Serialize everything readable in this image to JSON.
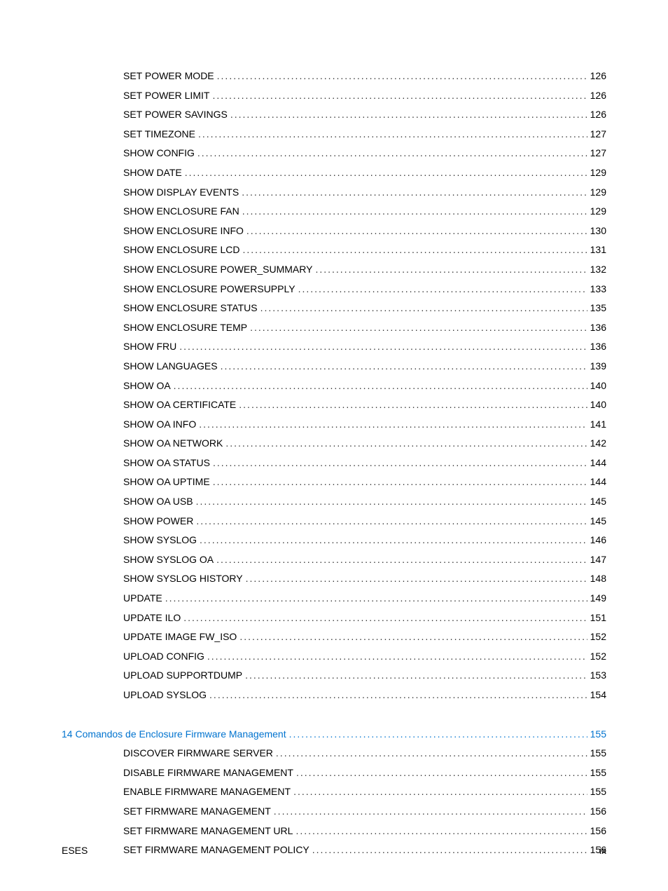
{
  "toc": {
    "items": [
      {
        "label": "SET POWER MODE",
        "page": "126",
        "indent": 1,
        "section": false,
        "link": true
      },
      {
        "label": "SET POWER LIMIT",
        "page": "126",
        "indent": 1,
        "section": false,
        "link": true
      },
      {
        "label": "SET POWER SAVINGS",
        "page": "126",
        "indent": 1,
        "section": false,
        "link": true
      },
      {
        "label": "SET TIMEZONE",
        "page": "127",
        "indent": 1,
        "section": false,
        "link": true
      },
      {
        "label": "SHOW CONFIG",
        "page": "127",
        "indent": 1,
        "section": false,
        "link": true
      },
      {
        "label": "SHOW DATE",
        "page": "129",
        "indent": 1,
        "section": false,
        "link": true
      },
      {
        "label": "SHOW DISPLAY EVENTS",
        "page": "129",
        "indent": 1,
        "section": false,
        "link": true
      },
      {
        "label": "SHOW ENCLOSURE FAN",
        "page": "129",
        "indent": 1,
        "section": false,
        "link": true
      },
      {
        "label": "SHOW ENCLOSURE INFO",
        "page": "130",
        "indent": 1,
        "section": false,
        "link": true
      },
      {
        "label": "SHOW ENCLOSURE LCD",
        "page": "131",
        "indent": 1,
        "section": false,
        "link": true
      },
      {
        "label": "SHOW ENCLOSURE POWER_SUMMARY",
        "page": "132",
        "indent": 1,
        "section": false,
        "link": true
      },
      {
        "label": "SHOW ENCLOSURE POWERSUPPLY",
        "page": "133",
        "indent": 1,
        "section": false,
        "link": true
      },
      {
        "label": "SHOW ENCLOSURE STATUS",
        "page": "135",
        "indent": 1,
        "section": false,
        "link": true
      },
      {
        "label": "SHOW ENCLOSURE TEMP",
        "page": "136",
        "indent": 1,
        "section": false,
        "link": true
      },
      {
        "label": "SHOW FRU",
        "page": "136",
        "indent": 1,
        "section": false,
        "link": true
      },
      {
        "label": "SHOW LANGUAGES",
        "page": "139",
        "indent": 1,
        "section": false,
        "link": true
      },
      {
        "label": "SHOW OA",
        "page": "140",
        "indent": 1,
        "section": false,
        "link": true
      },
      {
        "label": "SHOW OA CERTIFICATE",
        "page": "140",
        "indent": 1,
        "section": false,
        "link": true
      },
      {
        "label": "SHOW OA INFO",
        "page": "141",
        "indent": 1,
        "section": false,
        "link": true
      },
      {
        "label": "SHOW OA NETWORK",
        "page": "142",
        "indent": 1,
        "section": false,
        "link": true
      },
      {
        "label": "SHOW OA STATUS",
        "page": "144",
        "indent": 1,
        "section": false,
        "link": true
      },
      {
        "label": "SHOW OA UPTIME",
        "page": "144",
        "indent": 1,
        "section": false,
        "link": true
      },
      {
        "label": "SHOW OA USB",
        "page": "145",
        "indent": 1,
        "section": false,
        "link": true
      },
      {
        "label": "SHOW POWER",
        "page": "145",
        "indent": 1,
        "section": false,
        "link": true
      },
      {
        "label": "SHOW SYSLOG",
        "page": "146",
        "indent": 1,
        "section": false,
        "link": true
      },
      {
        "label": "SHOW SYSLOG OA",
        "page": "147",
        "indent": 1,
        "section": false,
        "link": true
      },
      {
        "label": "SHOW SYSLOG HISTORY",
        "page": "148",
        "indent": 1,
        "section": false,
        "link": true
      },
      {
        "label": "UPDATE",
        "page": "149",
        "indent": 1,
        "section": false,
        "link": true
      },
      {
        "label": "UPDATE ILO",
        "page": "151",
        "indent": 1,
        "section": false,
        "link": true
      },
      {
        "label": "UPDATE IMAGE FW_ISO",
        "page": "152",
        "indent": 1,
        "section": false,
        "link": true
      },
      {
        "label": "UPLOAD CONFIG",
        "page": "152",
        "indent": 1,
        "section": false,
        "link": true
      },
      {
        "label": "UPLOAD SUPPORTDUMP",
        "page": "153",
        "indent": 1,
        "section": false,
        "link": true
      },
      {
        "label": "UPLOAD SYSLOG",
        "page": "154",
        "indent": 1,
        "section": false,
        "link": true
      },
      {
        "gap": true
      },
      {
        "label": "14  Comandos de Enclosure Firmware Management",
        "page": "155",
        "indent": 0,
        "section": true,
        "link": true
      },
      {
        "label": "DISCOVER FIRMWARE SERVER",
        "page": "155",
        "indent": 1,
        "section": false,
        "link": true
      },
      {
        "label": "DISABLE FIRMWARE MANAGEMENT",
        "page": "155",
        "indent": 1,
        "section": false,
        "link": true
      },
      {
        "label": "ENABLE FIRMWARE MANAGEMENT",
        "page": "155",
        "indent": 1,
        "section": false,
        "link": true
      },
      {
        "label": "SET FIRMWARE MANAGEMENT",
        "page": "156",
        "indent": 1,
        "section": false,
        "link": true
      },
      {
        "label": "SET FIRMWARE MANAGEMENT URL",
        "page": "156",
        "indent": 1,
        "section": false,
        "link": true
      },
      {
        "label": "SET FIRMWARE MANAGEMENT POLICY",
        "page": "156",
        "indent": 1,
        "section": false,
        "link": true
      }
    ]
  },
  "footer": {
    "left": "ESES",
    "right": "ix"
  }
}
